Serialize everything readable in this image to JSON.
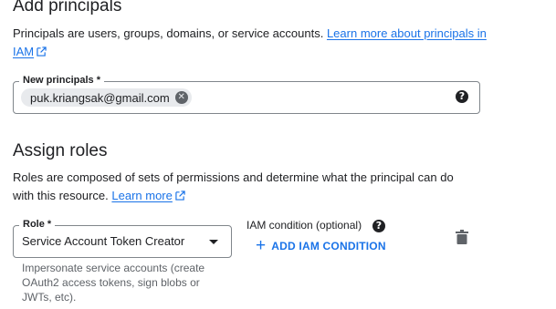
{
  "principals": {
    "heading": "Add principals",
    "description": "Principals are users, groups, domains, or service accounts.",
    "learn_more_link": "Learn more about principals in IAM",
    "field_label": "New principals *",
    "chips": [
      "puk.kriangsak@gmail.com"
    ],
    "help_icon": "help-icon"
  },
  "roles": {
    "heading": "Assign roles",
    "description": "Roles are composed of sets of permissions and determine what the principal can do with this resource.",
    "learn_more_link": "Learn more",
    "role_label": "Role *",
    "role_value": "Service Account Token Creator",
    "role_hint": "Impersonate service accounts (create OAuth2 access tokens, sign blobs or JWTs, etc).",
    "condition_title": "IAM condition (optional)",
    "add_condition_button": "ADD IAM CONDITION",
    "delete_icon": "trash-icon"
  },
  "colors": {
    "link": "#1a73e8",
    "text": "#202124",
    "secondary_text": "#5f6368",
    "chip_bg": "#e8eaed",
    "border": "#80868b"
  }
}
